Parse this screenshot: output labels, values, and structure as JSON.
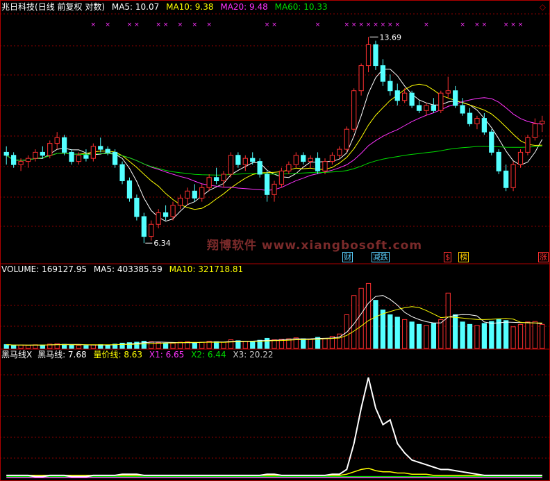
{
  "main_header": {
    "stock_name": "兆日科技",
    "period": "(日线 前复权 对数)",
    "ma5": "MA5: 10.07",
    "ma10": "MA10: 9.38",
    "ma20": "MA20: 9.48",
    "ma60": "MA60: 10.33"
  },
  "corner_icon": "diamond-icon",
  "price_labels": {
    "high": "13.69",
    "low": "6.34"
  },
  "watermark": "翔博软件 www.xiangbosoft.com",
  "event_tags": [
    {
      "label": "财",
      "color": "#5ad0ff"
    },
    {
      "label": "减跌",
      "color": "#5ad0ff"
    },
    {
      "label": "$",
      "color": "#ff3030"
    },
    {
      "label": "榜",
      "color": "#ffcc00"
    },
    {
      "label": "涨",
      "color": "#ff3030"
    }
  ],
  "volume_header": {
    "volume": "VOLUME: 169127.95",
    "ma5": "MA5: 403385.59",
    "ma10": "MA10: 321718.81"
  },
  "indicator_header": {
    "name": "黑马线X",
    "hmx": "黑马线: 7.68",
    "ljx": "量价线: 8.63",
    "x1": "X1: 6.65",
    "x2": "X2: 6.44",
    "x3": "X3: 20.22"
  },
  "colors": {
    "up": "#ff3030",
    "down": "#54ffff",
    "ma5": "#ffffff",
    "ma10": "#ffff00",
    "ma20": "#ff33ff",
    "ma60": "#00dd00",
    "grid": "#8b0000",
    "separator": "#b00000",
    "marker": "#ff33ff"
  },
  "chart_data": {
    "type": "candlestick",
    "price_axis": "log",
    "price_range": [
      5.9,
      15.0
    ],
    "highest_price": 13.69,
    "lowest_price": 6.34,
    "candles": [
      [
        8.9,
        9.1,
        8.5,
        8.8
      ],
      [
        8.8,
        8.9,
        8.4,
        8.5
      ],
      [
        8.5,
        8.7,
        8.3,
        8.6
      ],
      [
        8.6,
        8.8,
        8.4,
        8.7
      ],
      [
        8.7,
        9.0,
        8.6,
        8.9
      ],
      [
        8.9,
        9.1,
        8.7,
        8.8
      ],
      [
        8.8,
        9.3,
        8.7,
        9.2
      ],
      [
        9.2,
        9.6,
        9.0,
        9.4
      ],
      [
        9.4,
        9.5,
        8.8,
        8.9
      ],
      [
        8.9,
        9.0,
        8.5,
        8.6
      ],
      [
        8.6,
        8.9,
        8.5,
        8.8
      ],
      [
        8.8,
        9.0,
        8.6,
        8.7
      ],
      [
        8.7,
        9.2,
        8.6,
        9.1
      ],
      [
        9.1,
        9.4,
        8.9,
        9.0
      ],
      [
        9.0,
        9.1,
        8.8,
        8.9
      ],
      [
        8.9,
        9.0,
        8.4,
        8.5
      ],
      [
        8.5,
        8.6,
        7.9,
        8.0
      ],
      [
        8.0,
        8.1,
        7.4,
        7.5
      ],
      [
        7.5,
        7.6,
        6.9,
        7.0
      ],
      [
        7.0,
        7.1,
        6.34,
        6.5
      ],
      [
        6.5,
        6.9,
        6.4,
        6.8
      ],
      [
        6.8,
        7.2,
        6.7,
        7.1
      ],
      [
        7.1,
        7.3,
        6.9,
        7.0
      ],
      [
        7.0,
        7.4,
        6.9,
        7.3
      ],
      [
        7.3,
        7.6,
        7.2,
        7.5
      ],
      [
        7.5,
        7.8,
        7.3,
        7.7
      ],
      [
        7.7,
        7.9,
        7.4,
        7.5
      ],
      [
        7.5,
        7.9,
        7.4,
        7.8
      ],
      [
        7.8,
        8.2,
        7.7,
        8.1
      ],
      [
        8.1,
        8.4,
        7.9,
        8.0
      ],
      [
        8.0,
        8.3,
        7.8,
        8.2
      ],
      [
        8.2,
        8.9,
        8.1,
        8.8
      ],
      [
        8.8,
        8.9,
        8.4,
        8.5
      ],
      [
        8.5,
        8.8,
        8.3,
        8.7
      ],
      [
        8.7,
        8.9,
        8.5,
        8.6
      ],
      [
        8.6,
        8.7,
        8.1,
        8.2
      ],
      [
        8.2,
        8.3,
        7.4,
        7.6
      ],
      [
        7.6,
        8.0,
        7.4,
        7.9
      ],
      [
        7.9,
        8.4,
        7.8,
        8.3
      ],
      [
        8.3,
        8.6,
        8.2,
        8.5
      ],
      [
        8.5,
        8.9,
        8.4,
        8.8
      ],
      [
        8.8,
        8.9,
        8.5,
        8.6
      ],
      [
        8.6,
        8.8,
        8.4,
        8.7
      ],
      [
        8.7,
        8.9,
        8.2,
        8.3
      ],
      [
        8.3,
        8.7,
        8.2,
        8.6
      ],
      [
        8.6,
        8.9,
        8.5,
        8.8
      ],
      [
        8.8,
        9.1,
        8.7,
        9.0
      ],
      [
        9.0,
        9.8,
        8.9,
        9.7
      ],
      [
        9.7,
        11.3,
        9.6,
        11.2
      ],
      [
        11.2,
        12.4,
        11.0,
        12.3
      ],
      [
        12.3,
        13.69,
        12.0,
        13.3
      ],
      [
        13.3,
        13.5,
        12.1,
        12.3
      ],
      [
        12.3,
        12.6,
        11.4,
        11.6
      ],
      [
        11.6,
        11.9,
        11.0,
        11.2
      ],
      [
        11.2,
        11.5,
        10.6,
        10.8
      ],
      [
        10.8,
        11.3,
        10.7,
        11.1
      ],
      [
        11.1,
        11.2,
        10.5,
        10.6
      ],
      [
        10.6,
        10.8,
        10.3,
        10.4
      ],
      [
        10.4,
        10.7,
        10.2,
        10.6
      ],
      [
        10.6,
        10.9,
        10.3,
        10.4
      ],
      [
        10.4,
        11.2,
        10.3,
        11.1
      ],
      [
        11.1,
        11.8,
        10.9,
        11.2
      ],
      [
        11.2,
        11.4,
        10.5,
        10.6
      ],
      [
        10.6,
        10.9,
        10.2,
        10.3
      ],
      [
        10.3,
        10.5,
        9.8,
        9.9
      ],
      [
        9.9,
        10.2,
        9.7,
        10.1
      ],
      [
        10.1,
        10.3,
        9.5,
        9.6
      ],
      [
        9.6,
        9.7,
        8.8,
        8.9
      ],
      [
        8.9,
        9.0,
        8.2,
        8.3
      ],
      [
        8.3,
        8.5,
        7.7,
        7.8
      ],
      [
        7.8,
        8.6,
        7.7,
        8.5
      ],
      [
        8.5,
        9.0,
        8.4,
        8.9
      ],
      [
        8.9,
        9.5,
        8.8,
        9.4
      ],
      [
        9.4,
        10.1,
        9.3,
        9.9
      ],
      [
        9.9,
        10.2,
        9.6,
        10.0
      ]
    ],
    "volume_max": 1500000,
    "volumes": [
      80000,
      60000,
      70000,
      65000,
      75000,
      70000,
      90000,
      100000,
      85000,
      70000,
      65000,
      60000,
      75000,
      80000,
      70000,
      90000,
      110000,
      120000,
      130000,
      150000,
      140000,
      120000,
      100000,
      110000,
      130000,
      140000,
      120000,
      130000,
      150000,
      140000,
      130000,
      180000,
      160000,
      150000,
      140000,
      170000,
      210000,
      180000,
      190000,
      200000,
      220000,
      200000,
      190000,
      230000,
      210000,
      250000,
      300000,
      700000,
      1100000,
      1250000,
      1350000,
      1000000,
      800000,
      700000,
      650000,
      600000,
      550000,
      500000,
      480000,
      520000,
      600000,
      1150000,
      700000,
      550000,
      500000,
      480000,
      520000,
      560000,
      600000,
      580000,
      450000,
      500000,
      550000,
      560000,
      500000
    ],
    "indicator_range": [
      0,
      100
    ],
    "indicator_series": [
      {
        "name": "黑马线",
        "values": [
          3,
          3,
          3,
          3,
          2,
          2,
          3,
          3,
          3,
          2,
          2,
          2,
          3,
          3,
          3,
          3,
          4,
          4,
          4,
          3,
          3,
          3,
          3,
          3,
          3,
          3,
          3,
          3,
          3,
          3,
          3,
          3,
          3,
          3,
          3,
          3,
          4,
          4,
          3,
          3,
          3,
          3,
          3,
          3,
          3,
          4,
          4,
          8,
          30,
          60,
          86,
          60,
          46,
          50,
          30,
          22,
          16,
          14,
          12,
          10,
          8,
          8,
          7,
          6,
          5,
          4,
          3,
          3,
          3,
          3,
          3,
          3,
          3,
          3,
          3
        ]
      },
      {
        "name": "量价线",
        "values": [
          3,
          3,
          3,
          3,
          3,
          3,
          3,
          3,
          3,
          3,
          3,
          3,
          3,
          3,
          3,
          3,
          3,
          3,
          3,
          3,
          3,
          3,
          3,
          3,
          3,
          3,
          3,
          3,
          3,
          3,
          3,
          3,
          3,
          3,
          3,
          3,
          3,
          3,
          3,
          3,
          3,
          3,
          3,
          3,
          3,
          3,
          3,
          4,
          6,
          8,
          9,
          7,
          6,
          6,
          5,
          5,
          4,
          4,
          4,
          3,
          3,
          3,
          3,
          3,
          3,
          3,
          3,
          3,
          3,
          3,
          3,
          3,
          3,
          3,
          3
        ]
      },
      {
        "name": "X1",
        "values": [
          1,
          1,
          1,
          1,
          1,
          1,
          1,
          1,
          1,
          1,
          1,
          1,
          1,
          1,
          1,
          1,
          1,
          1,
          1,
          1,
          1,
          1,
          1,
          1,
          1,
          1,
          1,
          1,
          1,
          1,
          1,
          1,
          1,
          1,
          1,
          1,
          1,
          1,
          1,
          1,
          1,
          1,
          1,
          1,
          1,
          1,
          1,
          1,
          1,
          1,
          1,
          1,
          1,
          1,
          1,
          1,
          1,
          1,
          1,
          1,
          1,
          1,
          1,
          1,
          1,
          1,
          1,
          1,
          1,
          1,
          1,
          1,
          1,
          1,
          1
        ]
      },
      {
        "name": "X2",
        "values": [
          2,
          2,
          2,
          2,
          2,
          2,
          2,
          2,
          2,
          2,
          2,
          2,
          2,
          2,
          2,
          2,
          2,
          2,
          2,
          2,
          2,
          2,
          2,
          2,
          2,
          2,
          2,
          2,
          2,
          2,
          2,
          2,
          2,
          2,
          2,
          2,
          2,
          2,
          2,
          2,
          2,
          2,
          2,
          2,
          2,
          2,
          2,
          2,
          2,
          2,
          2,
          2,
          2,
          2,
          2,
          2,
          2,
          2,
          2,
          2,
          2,
          2,
          2,
          2,
          2,
          2,
          2,
          2,
          2,
          2,
          2,
          2,
          2,
          2,
          2
        ]
      }
    ],
    "marker_candles": [
      12,
      14,
      17,
      18,
      21,
      22,
      24,
      26,
      28,
      36,
      37,
      43,
      47,
      48,
      49,
      50,
      51,
      52,
      53,
      54,
      58,
      63,
      65,
      66,
      69,
      70,
      71
    ],
    "event_tag_candles": [
      47,
      51,
      61,
      63,
      74
    ]
  }
}
